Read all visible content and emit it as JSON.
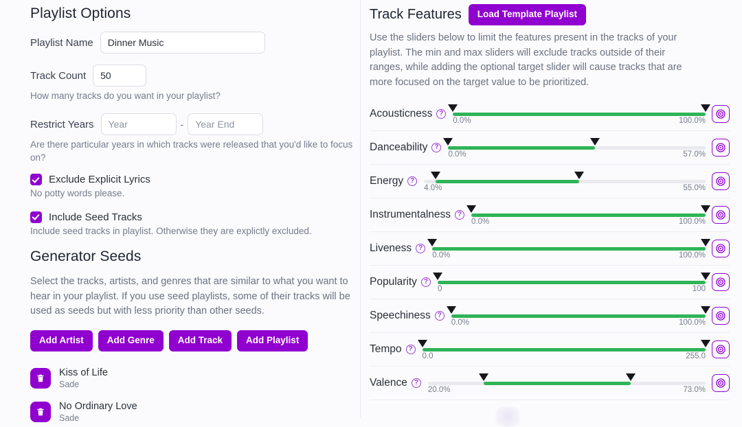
{
  "playlist_options": {
    "heading": "Playlist Options",
    "name_label": "Playlist Name",
    "name_value": "Dinner Music",
    "track_count_label": "Track Count",
    "track_count_value": "50",
    "track_count_help": "How many tracks do you want in your playlist?",
    "restrict_years_label": "Restrict Years",
    "year_start_placeholder": "Year",
    "year_end_placeholder": "Year End",
    "year_separator": "-",
    "years_help": "Are there particular years in which tracks were released that you'd like to focus on?",
    "exclude_explicit_label": "Exclude Explicit Lyrics",
    "exclude_explicit_help": "No potty words please.",
    "include_seed_label": "Include Seed Tracks",
    "include_seed_help": "Include seed tracks in playlist. Otherwise they are explictly excluded."
  },
  "generator_seeds": {
    "heading": "Generator Seeds",
    "description": "Select the tracks, artists, and genres that are similar to what you want to hear in your playlist. If you use seed playlists, some of their tracks will be used as seeds but with less priority than other seeds.",
    "buttons": [
      {
        "label": "Add Artist",
        "name": "add-artist-button"
      },
      {
        "label": "Add Genre",
        "name": "add-genre-button"
      },
      {
        "label": "Add Track",
        "name": "add-track-button"
      },
      {
        "label": "Add Playlist",
        "name": "add-playlist-button"
      }
    ],
    "seeds": [
      {
        "title": "Kiss of Life",
        "artist": "Sade",
        "icon": "trash-icon"
      },
      {
        "title": "No Ordinary Love",
        "artist": "Sade",
        "icon": "trash-icon"
      }
    ]
  },
  "track_features": {
    "heading": "Track Features",
    "load_template_label": "Load Template Playlist",
    "description": "Use the sliders below to limit the features present in the tracks of your playlist. The min and max sliders will exclude tracks outside of their ranges, while adding the optional target slider will cause tracks that are more focused on the target value to be prioritized.",
    "help_icon": "question-mark-icon",
    "target_icon": "target-icon",
    "sliders": [
      {
        "label": "Acousticness",
        "min_label": "0.0%",
        "max_label": "100.0%",
        "min_pct": 0,
        "max_pct": 100
      },
      {
        "label": "Danceability",
        "min_label": "0.0%",
        "max_label": "57.0%",
        "min_pct": 0,
        "max_pct": 57
      },
      {
        "label": "Energy",
        "min_label": "4.0%",
        "max_label": "55.0%",
        "min_pct": 4,
        "max_pct": 55
      },
      {
        "label": "Instrumentalness",
        "min_label": "0.0%",
        "max_label": "100.0%",
        "min_pct": 0,
        "max_pct": 100
      },
      {
        "label": "Liveness",
        "min_label": "0.0%",
        "max_label": "100.0%",
        "min_pct": 0,
        "max_pct": 100
      },
      {
        "label": "Popularity",
        "min_label": "0",
        "max_label": "100",
        "min_pct": 0,
        "max_pct": 100
      },
      {
        "label": "Speechiness",
        "min_label": "0.0%",
        "max_label": "100.0%",
        "min_pct": 0,
        "max_pct": 100
      },
      {
        "label": "Tempo",
        "min_label": "0.0",
        "max_label": "255.0",
        "min_pct": 0,
        "max_pct": 100
      },
      {
        "label": "Valence",
        "min_label": "20.0%",
        "max_label": "73.0%",
        "min_pct": 20,
        "max_pct": 73
      }
    ]
  },
  "colors": {
    "accent": "#9000cf",
    "slider_fill": "#2fb457",
    "slider_track": "#e9e9ef",
    "background": "#fbfbfd"
  }
}
